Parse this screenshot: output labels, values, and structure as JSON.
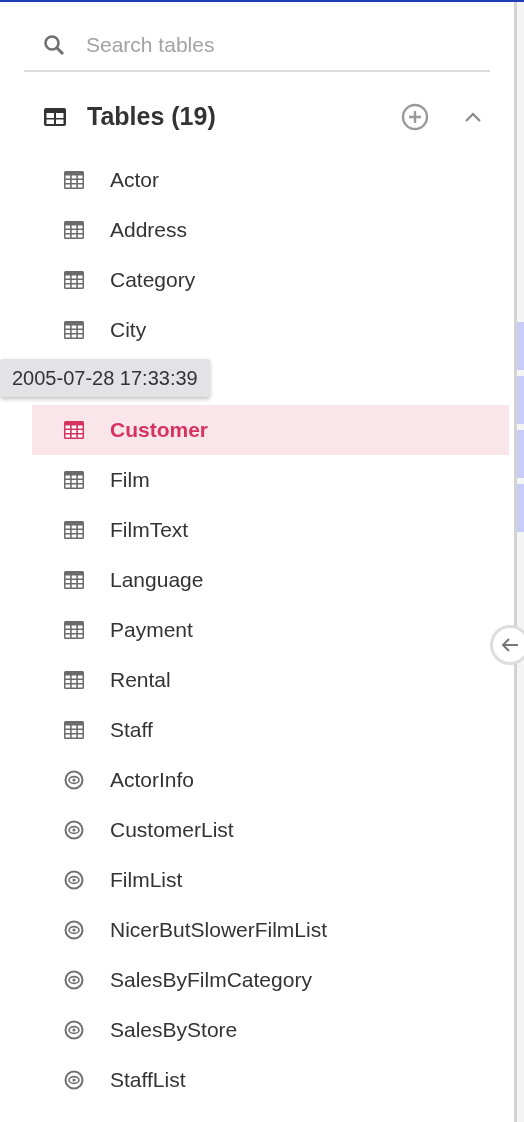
{
  "search": {
    "placeholder": "Search tables"
  },
  "section": {
    "title": "Tables (19)",
    "expanded": true
  },
  "items": [
    {
      "kind": "table",
      "label": "Actor",
      "selected": false
    },
    {
      "kind": "table",
      "label": "Address",
      "selected": false
    },
    {
      "kind": "table",
      "label": "Category",
      "selected": false
    },
    {
      "kind": "table",
      "label": "City",
      "selected": false
    },
    {
      "kind": "covered",
      "tooltip": "2005-07-28 17:33:39"
    },
    {
      "kind": "table",
      "label": "Customer",
      "selected": true
    },
    {
      "kind": "table",
      "label": "Film",
      "selected": false
    },
    {
      "kind": "table",
      "label": "FilmText",
      "selected": false
    },
    {
      "kind": "table",
      "label": "Language",
      "selected": false
    },
    {
      "kind": "table",
      "label": "Payment",
      "selected": false
    },
    {
      "kind": "table",
      "label": "Rental",
      "selected": false
    },
    {
      "kind": "table",
      "label": "Staff",
      "selected": false
    },
    {
      "kind": "view",
      "label": "ActorInfo",
      "selected": false
    },
    {
      "kind": "view",
      "label": "CustomerList",
      "selected": false
    },
    {
      "kind": "view",
      "label": "FilmList",
      "selected": false
    },
    {
      "kind": "view",
      "label": "NicerButSlowerFilmList",
      "selected": false
    },
    {
      "kind": "view",
      "label": "SalesByFilmCategory",
      "selected": false
    },
    {
      "kind": "view",
      "label": "SalesByStore",
      "selected": false
    },
    {
      "kind": "view",
      "label": "StaffList",
      "selected": false
    }
  ]
}
